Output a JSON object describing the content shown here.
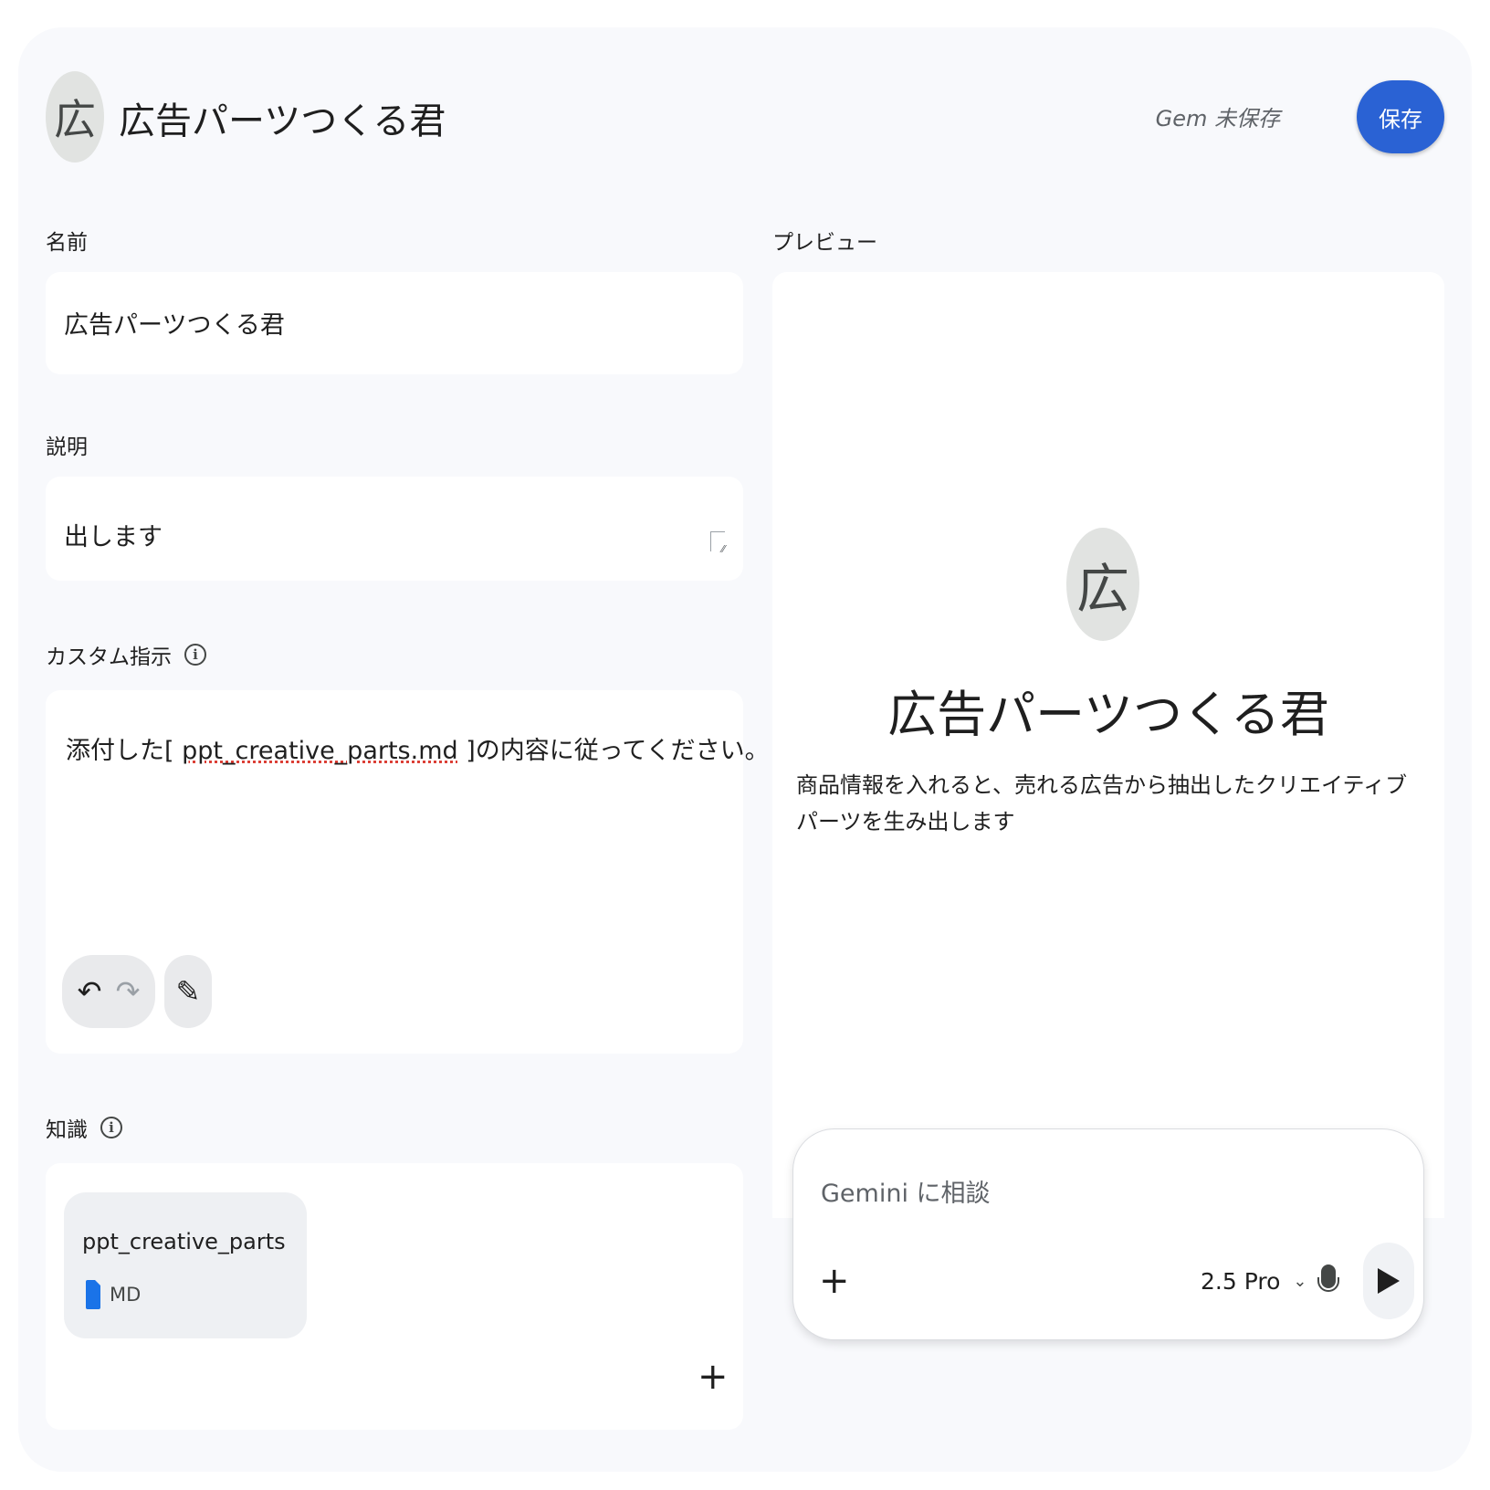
{
  "header": {
    "avatar_letter": "広",
    "title": "広告パーツつくる君",
    "status": "Gem 未保存",
    "save_label": "保存"
  },
  "form": {
    "name": {
      "label": "名前",
      "value": "広告パーツつくる君"
    },
    "description": {
      "label": "説明",
      "value": "出します"
    },
    "instructions": {
      "label": "カスタム指示",
      "value_before": "添付した[ ",
      "value_link": "ppt_creative_parts.md",
      "value_after": " ]の内容に従ってください。",
      "undo_icon": "undo-icon",
      "redo_icon": "redo-icon",
      "magic_icon": "magic-pen-icon"
    },
    "knowledge": {
      "label": "知識",
      "files": [
        {
          "name": "ppt_creative_parts",
          "type": "MD"
        }
      ]
    }
  },
  "preview": {
    "label": "プレビュー",
    "avatar_letter": "広",
    "title": "広告パーツつくる君",
    "description": "商品情報を入れると、売れる広告から抽出したクリエイティブパーツを生み出します",
    "chat": {
      "placeholder": "Gemini に相談",
      "model": "2.5 Pro"
    }
  },
  "colors": {
    "accent": "#2a62d4",
    "card_bg": "#f8f9fc",
    "field_bg": "#ffffff",
    "file_icon": "#1a73e8"
  }
}
